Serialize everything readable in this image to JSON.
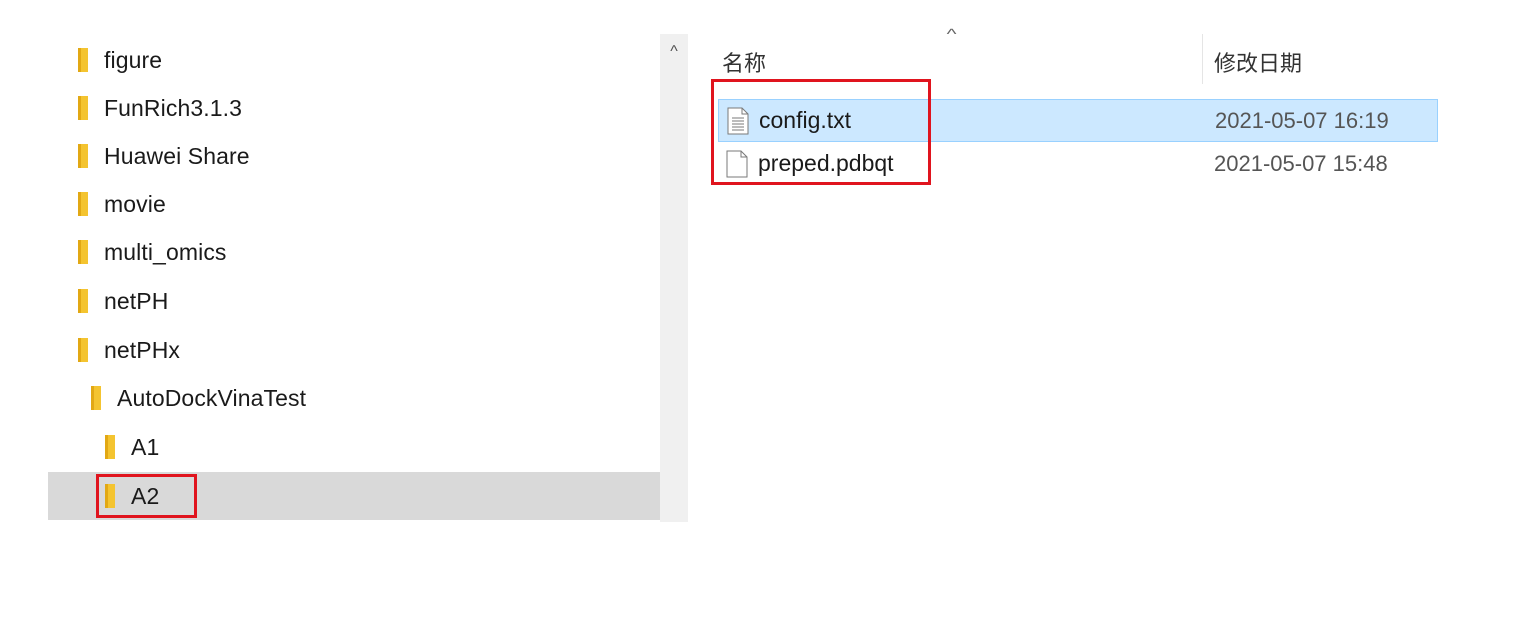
{
  "nav_tree": {
    "items": [
      {
        "label": "figure"
      },
      {
        "label": "FunRich3.1.3"
      },
      {
        "label": "Huawei Share"
      },
      {
        "label": "movie"
      },
      {
        "label": "multi_omics"
      },
      {
        "label": "netPH"
      },
      {
        "label": "netPHx"
      },
      {
        "label": "AutoDockVinaTest"
      },
      {
        "label": "A1"
      },
      {
        "label": "A2"
      }
    ],
    "selected_label": "A2",
    "scroll_up_glyph": "^"
  },
  "file_list": {
    "columns": {
      "name": "名称",
      "date_modified": "修改日期"
    },
    "sort_indicator": "^",
    "rows": [
      {
        "name": "config.txt",
        "date_modified": "2021-05-07 16:19",
        "icon": "text-file-icon",
        "selected": true
      },
      {
        "name": "preped.pdbqt",
        "date_modified": "2021-05-07 15:48",
        "icon": "blank-file-icon",
        "selected": false
      }
    ]
  },
  "colors": {
    "folder": "#f4c430",
    "folder_dark": "#e2a814",
    "selection_nav": "#d9d9d9",
    "selection_file": "#cce8ff",
    "annotation_red": "#e0141e"
  }
}
